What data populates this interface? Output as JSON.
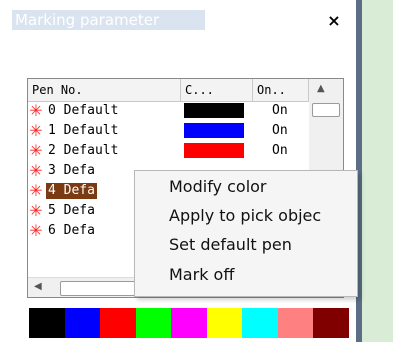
{
  "window": {
    "title": "Marking parameter",
    "close_glyph": "×"
  },
  "list": {
    "columns": [
      "Pen No.",
      "C...",
      "On..",
      ""
    ],
    "selected_index": 4,
    "rows": [
      {
        "label": "0 Default",
        "color": "#000000",
        "on": "On"
      },
      {
        "label": "1 Default",
        "color": "#0000ff",
        "on": "On"
      },
      {
        "label": "2 Default",
        "color": "#ff0000",
        "on": "On"
      },
      {
        "label": "3 Defa",
        "color": "",
        "on": ""
      },
      {
        "label": "4 Defa",
        "color": "",
        "on": ""
      },
      {
        "label": "5 Defa",
        "color": "",
        "on": ""
      },
      {
        "label": "6 Defa",
        "color": "",
        "on": ""
      }
    ],
    "row_icon": "red-star-icon"
  },
  "scrollbars": {
    "up_glyph": "▲",
    "left_glyph": "◀"
  },
  "context_menu": {
    "items": [
      "Modify color",
      "Apply to pick objec",
      "Set default pen",
      "Mark off"
    ]
  },
  "palette": [
    "#000000",
    "#0000ff",
    "#ff0000",
    "#00ff00",
    "#ff00ff",
    "#ffff00",
    "#00ffff",
    "#ff8080",
    "#800000"
  ]
}
